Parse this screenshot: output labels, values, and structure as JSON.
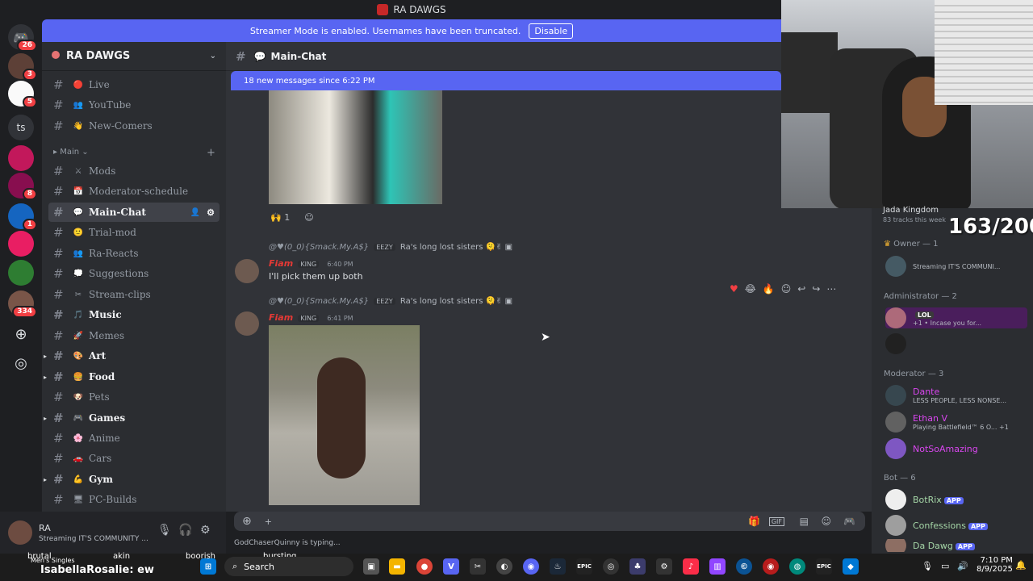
{
  "app": {
    "server_name": "RA DAWGS"
  },
  "streamer_bar": {
    "text": "Streamer Mode is enabled. Usernames have been truncated.",
    "button": "Disable"
  },
  "rail": {
    "badges": [
      "26",
      "3",
      "5",
      "8",
      "1",
      "334"
    ],
    "ts_label": "ts"
  },
  "sidebar": {
    "category": "Main",
    "channels": [
      {
        "name": "Live",
        "emoji": "🔴"
      },
      {
        "name": "YouTube",
        "emoji": "👥"
      },
      {
        "name": "New-Comers",
        "emoji": "👋"
      },
      {
        "name": "Mods",
        "emoji": "⚔"
      },
      {
        "name": "Moderator-schedule",
        "emoji": "📅"
      },
      {
        "name": "Main-Chat",
        "emoji": "💬"
      },
      {
        "name": "Trial-mod",
        "emoji": "🙂"
      },
      {
        "name": "Ra-Reacts",
        "emoji": "👥"
      },
      {
        "name": "Suggestions",
        "emoji": "💭"
      },
      {
        "name": "Stream-clips",
        "emoji": "✂"
      },
      {
        "name": "Music",
        "emoji": "🎵"
      },
      {
        "name": "Memes",
        "emoji": "🚀"
      },
      {
        "name": "Art",
        "emoji": "🎨"
      },
      {
        "name": "Food",
        "emoji": "🍔"
      },
      {
        "name": "Pets",
        "emoji": "🐶"
      },
      {
        "name": "Games",
        "emoji": "🎮"
      },
      {
        "name": "Anime",
        "emoji": "🌸"
      },
      {
        "name": "Cars",
        "emoji": "🚗"
      },
      {
        "name": "Gym",
        "emoji": "💪"
      },
      {
        "name": "PC-Builds",
        "emoji": "🖥"
      }
    ]
  },
  "user_panel": {
    "name": "RA",
    "status": "Streaming IT'S COMMUNITY ..."
  },
  "chat": {
    "channel": "Main-Chat",
    "new_messages": "18 new messages since 6:22 PM",
    "reaction_count": "1",
    "messages": [
      {
        "reply_user": "@♥(0_0){Smack.My.A$}",
        "reply_tag": "EEZY",
        "reply_text": "Ra's long lost sisters 🫠✌",
        "author": "Fiam",
        "role": "KING",
        "time": "6:40 PM",
        "text": "I'll pick them up both"
      },
      {
        "reply_user": "@♥(0_0){Smack.My.A$}",
        "reply_tag": "EEZY",
        "reply_text": "Ra's long lost sisters 🫠✌",
        "author": "Fiam",
        "role": "KING",
        "time": "6:41 PM",
        "text": ""
      }
    ],
    "input_placeholder": "+",
    "typing": "GodChaserQuinny is typing..."
  },
  "members": {
    "header_name": "Jada Kingdom",
    "header_sub": "83 tracks this week",
    "groups": [
      {
        "label": "Owner — 1"
      },
      {
        "label": "Administrator — 2"
      },
      {
        "label": "Moderator — 3"
      },
      {
        "label": "Bot — 6"
      }
    ],
    "owner": {
      "status": "Streaming IT'S COMMUNI..."
    },
    "admins": [
      {
        "status": "+1 • Incase you for...",
        "badge": "LOL"
      }
    ],
    "mods": [
      {
        "name": "Dante",
        "status": "LESS PEOPLE, LESS NONSE..."
      },
      {
        "name": "Ethan V",
        "status": "Playing Battlefield™ 6 O... +1"
      },
      {
        "name": "NotSoAmazing",
        "status": ""
      }
    ],
    "bots": [
      {
        "name": "BotRix",
        "badge": "APP"
      },
      {
        "name": "Confessions",
        "badge": "APP"
      },
      {
        "name": "Da Dawg",
        "badge": "APP"
      }
    ]
  },
  "overlay": {
    "counter": "163/200"
  },
  "taskbar": {
    "search": "Search",
    "time": "7:10 PM",
    "date": "8/9/2025"
  },
  "stream_chat": {
    "words": [
      "brutal",
      "akin",
      "boorish",
      "bursting"
    ],
    "singles": "Men's Singles",
    "user": "IsabellaRosalie",
    "msg": ": ew"
  }
}
